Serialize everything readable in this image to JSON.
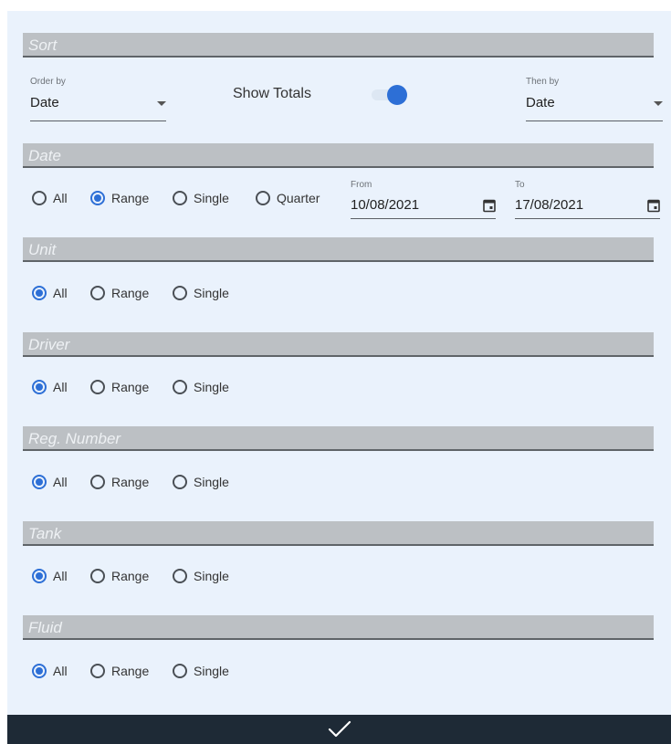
{
  "sort": {
    "title": "Sort",
    "order_by": {
      "caption": "Order by",
      "value": "Date"
    },
    "show_totals": {
      "label": "Show Totals",
      "checked": true
    },
    "then_by": {
      "caption": "Then by",
      "value": "Date"
    }
  },
  "date": {
    "title": "Date",
    "options": [
      "All",
      "Range",
      "Single",
      "Quarter"
    ],
    "selected": "Range",
    "from": {
      "caption": "From",
      "value": "10/08/2021"
    },
    "to": {
      "caption": "To",
      "value": "17/08/2021"
    }
  },
  "unit": {
    "title": "Unit",
    "options": [
      "All",
      "Range",
      "Single"
    ],
    "selected": "All"
  },
  "driver": {
    "title": "Driver",
    "options": [
      "All",
      "Range",
      "Single"
    ],
    "selected": "All"
  },
  "reg_number": {
    "title": "Reg. Number",
    "options": [
      "All",
      "Range",
      "Single"
    ],
    "selected": "All"
  },
  "tank": {
    "title": "Tank",
    "options": [
      "All",
      "Range",
      "Single"
    ],
    "selected": "All"
  },
  "fluid": {
    "title": "Fluid",
    "options": [
      "All",
      "Range",
      "Single"
    ],
    "selected": "All"
  },
  "footer": {
    "confirm_icon": "check-icon"
  },
  "colors": {
    "accent": "#2d6fd6",
    "header_bg": "#bcc0c4",
    "footer_bg": "#1e2a36",
    "panel_bg": "#eaf2fc"
  }
}
